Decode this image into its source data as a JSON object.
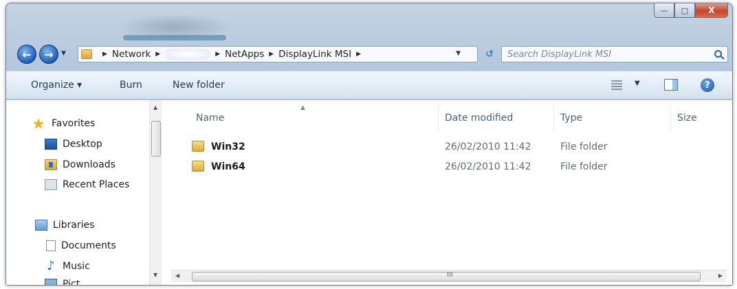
{
  "window": {
    "caption": {
      "minimize": "—",
      "maximize": "□",
      "close": "X"
    }
  },
  "nav": {
    "back_icon": "back-arrow-icon",
    "forward_icon": "forward-arrow-icon",
    "breadcrumb": [
      "Network",
      "",
      "NetApps",
      "DisplayLink MSI"
    ],
    "search_placeholder": "Search DisplayLink MSI"
  },
  "toolbar": {
    "organize_label": "Organize ▾",
    "burn_label": "Burn",
    "new_folder_label": "New folder",
    "help_label": "?"
  },
  "sidebar": {
    "favorites": {
      "label": "Favorites",
      "items": [
        "Desktop",
        "Downloads",
        "Recent Places"
      ]
    },
    "libraries": {
      "label": "Libraries",
      "items": [
        "Documents",
        "Music",
        "Pict"
      ]
    }
  },
  "file_list": {
    "columns": {
      "name": "Name",
      "date": "Date modified",
      "type": "Type",
      "size": "Size"
    },
    "rows": [
      {
        "name": "Win32",
        "date": "26/02/2010 11:42",
        "type": "File folder",
        "size": ""
      },
      {
        "name": "Win64",
        "date": "26/02/2010 11:42",
        "type": "File folder",
        "size": ""
      }
    ]
  },
  "scrollbar": {
    "grip": "III"
  },
  "colors": {
    "accent": "#1d5fb8",
    "close": "#c4452b",
    "folder": "#dcab3f"
  }
}
